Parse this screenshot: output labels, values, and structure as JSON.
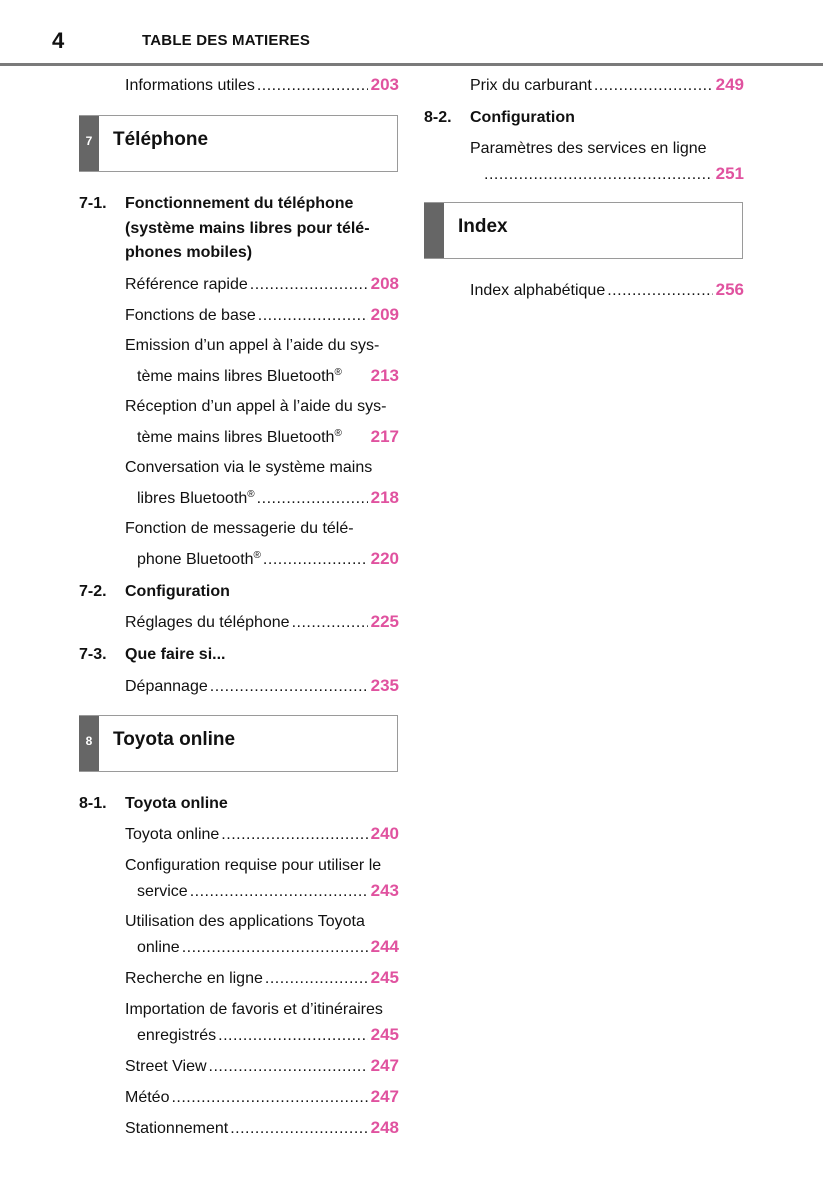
{
  "header": {
    "page_number": "4",
    "title": "TABLE DES MATIERES"
  },
  "accent_color": "#e0529f",
  "left_column": {
    "top_entry": {
      "text": "Informations utiles",
      "page": "203"
    },
    "chapter7": {
      "number": "7",
      "title": "Téléphone",
      "sections": [
        {
          "number": "7-1.",
          "title_lines": [
            "Fonctionnement du téléphone",
            "(système mains libres pour télé-",
            "phones mobiles)"
          ],
          "entries": [
            {
              "lines": [
                "Référence rapide"
              ],
              "page": "208"
            },
            {
              "lines": [
                "Fonctions de base"
              ],
              "page": "209"
            },
            {
              "lines": [
                "Emission d’un appel à l’aide du sys-",
                "tème mains libres Bluetooth"
              ],
              "sup": "®",
              "page": "213"
            },
            {
              "lines": [
                "Réception d’un appel à l’aide du sys-",
                "tème mains libres Bluetooth"
              ],
              "sup": "®",
              "page": "217"
            },
            {
              "lines": [
                "Conversation via le système mains",
                "libres Bluetooth"
              ],
              "sup": "®",
              "page": "218"
            },
            {
              "lines": [
                "Fonction de messagerie du télé-",
                "phone Bluetooth"
              ],
              "sup": "®",
              "page": "220"
            }
          ]
        },
        {
          "number": "7-2.",
          "title_lines": [
            "Configuration"
          ],
          "entries": [
            {
              "lines": [
                "Réglages du téléphone"
              ],
              "page": "225"
            }
          ]
        },
        {
          "number": "7-3.",
          "title_lines": [
            "Que faire si..."
          ],
          "entries": [
            {
              "lines": [
                "Dépannage"
              ],
              "page": "235"
            }
          ]
        }
      ]
    },
    "chapter8": {
      "number": "8",
      "title": "Toyota online",
      "sections": [
        {
          "number": "8-1.",
          "title_lines": [
            "Toyota online"
          ],
          "entries": [
            {
              "lines": [
                "Toyota online"
              ],
              "page": "240"
            },
            {
              "lines": [
                "Configuration requise pour utiliser le",
                "service"
              ],
              "page": "243"
            },
            {
              "lines": [
                "Utilisation des applications Toyota",
                "online"
              ],
              "page": "244"
            },
            {
              "lines": [
                "Recherche en ligne"
              ],
              "page": "245"
            },
            {
              "lines": [
                "Importation de favoris et d’itinéraires",
                "enregistrés"
              ],
              "page": "245"
            },
            {
              "lines": [
                "Street View"
              ],
              "page": "247"
            },
            {
              "lines": [
                "Météo"
              ],
              "page": "247"
            },
            {
              "lines": [
                "Stationnement"
              ],
              "page": "248"
            }
          ]
        }
      ]
    }
  },
  "right_column": {
    "top_entry": {
      "text": "Prix du carburant",
      "page": "249"
    },
    "section_8_2": {
      "number": "8-2.",
      "title": "Configuration",
      "entry": {
        "lines": [
          "Paramètres des services en ligne",
          ""
        ],
        "page": "251"
      }
    },
    "index_chapter": {
      "number": "",
      "title": "Index",
      "entry": {
        "text": "Index alphabétique",
        "page": "256"
      }
    }
  }
}
